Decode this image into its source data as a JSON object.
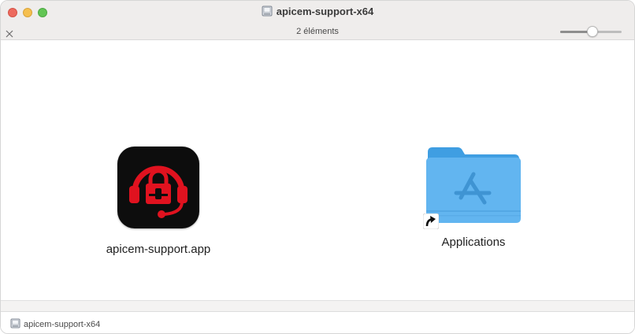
{
  "window": {
    "title": "apicem-support-x64",
    "title_icon": "disk-image-icon"
  },
  "statusbar": {
    "close_icon": "x-icon",
    "item_count": "2 éléments",
    "icon_size_slider_fraction": 0.52
  },
  "items": [
    {
      "label": "apicem-support.app",
      "icon": "apicem-app-icon"
    },
    {
      "label": "Applications",
      "icon": "applications-folder-icon",
      "alias": true
    }
  ],
  "pathbar": {
    "path": "apicem-support-x64",
    "icon": "disk-image-icon"
  },
  "colors": {
    "app_icon_accent": "#e0121f",
    "folder_blue": "#5fb2ee",
    "traffic_close": "#ed6a5e",
    "traffic_min": "#f5bf4f",
    "traffic_max": "#62c554"
  }
}
